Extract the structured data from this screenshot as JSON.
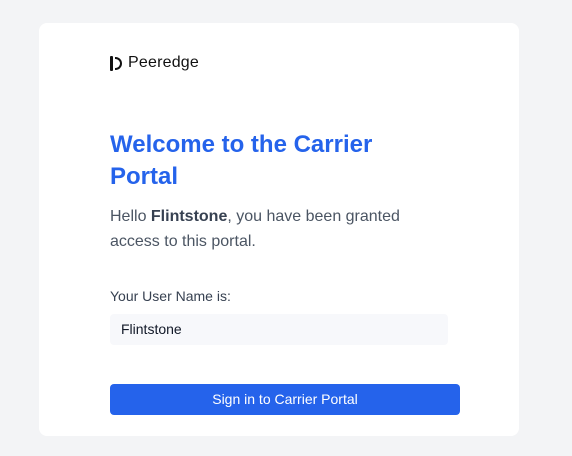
{
  "brand": {
    "name": "Peeredge",
    "icon": "peeredge-logo-icon"
  },
  "title": "Welcome to the Carrier Portal",
  "greeting": {
    "prefix": "Hello ",
    "user": "Flintstone",
    "suffix": ", you have been granted access to this portal."
  },
  "username": {
    "label": "Your User Name is:",
    "value": "Flintstone"
  },
  "signin_button": {
    "label": "Sign in to Carrier Portal"
  },
  "colors": {
    "accent": "#2563eb",
    "background": "#f3f4f6",
    "card": "#ffffff"
  }
}
